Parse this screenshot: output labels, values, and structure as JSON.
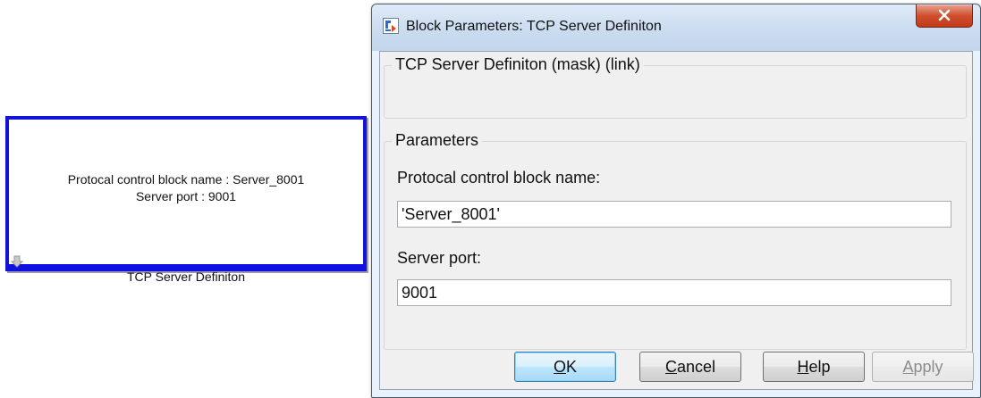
{
  "block": {
    "line1": "Protocal control block name : Server_8001",
    "line2": "Server port : 9001",
    "caption": "TCP Server Definiton"
  },
  "dialog": {
    "title": "Block Parameters: TCP Server Definiton",
    "description_header": "TCP Server Definiton (mask) (link)",
    "parameters_header": "Parameters",
    "fields": [
      {
        "label": "Protocal control block name:",
        "value": "'Server_8001'"
      },
      {
        "label": "Server port:",
        "value": "9001"
      }
    ],
    "buttons": {
      "ok": {
        "label": "OK",
        "mnemonic_index": 0
      },
      "cancel": {
        "label": "Cancel",
        "mnemonic_index": 0
      },
      "help": {
        "label": "Help",
        "mnemonic_index": 0
      },
      "apply": {
        "label": "Apply",
        "mnemonic_index": 0,
        "enabled": false
      }
    }
  },
  "colors": {
    "block_border": "#1414d8",
    "dialog_bg": "#f0f0f0",
    "close_button": "#c13a18",
    "default_button_border": "#3c7fb1"
  },
  "icons": {
    "block_port": "down-arrow-icon",
    "app": "simulink-block-icon",
    "close": "close-icon"
  }
}
